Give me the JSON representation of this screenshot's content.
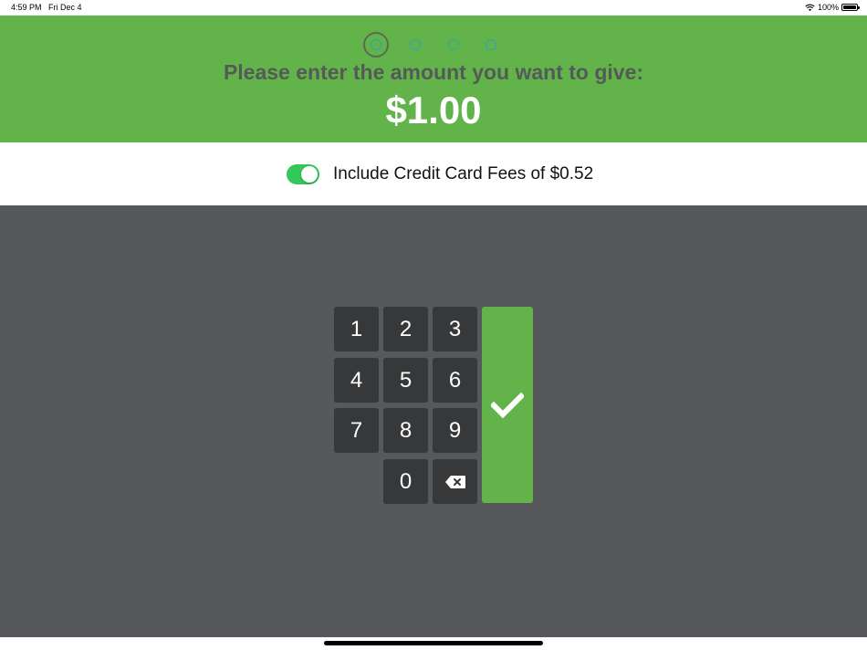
{
  "status_bar": {
    "time": "4:59 PM",
    "date": "Fri Dec 4",
    "battery": "100%"
  },
  "header": {
    "steps": {
      "count": 4,
      "active_index": 0
    },
    "prompt": "Please enter the amount you want to give:",
    "amount": "$1.00"
  },
  "fee": {
    "label": "Include Credit Card Fees of $0.52",
    "enabled": true
  },
  "keypad": {
    "keys": [
      "1",
      "2",
      "3",
      "4",
      "5",
      "6",
      "7",
      "8",
      "9",
      "0"
    ],
    "backspace_icon": "backspace-icon",
    "enter_icon": "checkmark-icon"
  },
  "colors": {
    "header_bg": "#62b34a",
    "keypad_bg": "#57585b",
    "key_bg": "#36383a",
    "toggle_on": "#34c759",
    "step_ring": "#2fa3b8"
  }
}
